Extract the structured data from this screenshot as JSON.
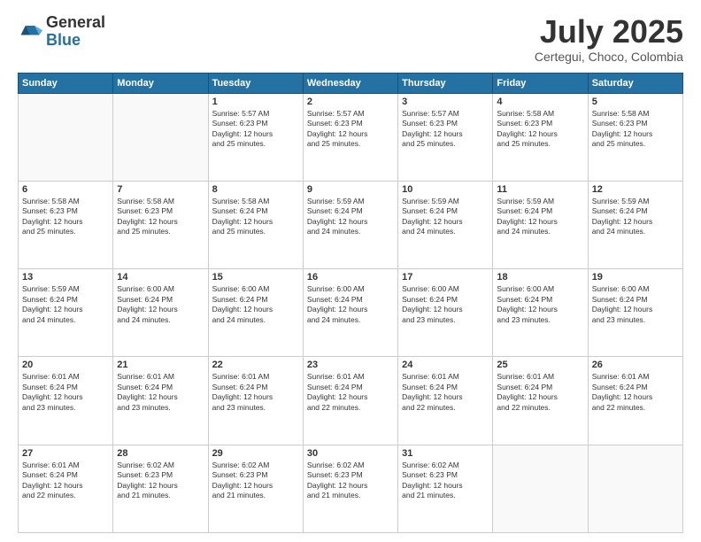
{
  "logo": {
    "general": "General",
    "blue": "Blue"
  },
  "header": {
    "month": "July 2025",
    "location": "Certegui, Choco, Colombia"
  },
  "weekdays": [
    "Sunday",
    "Monday",
    "Tuesday",
    "Wednesday",
    "Thursday",
    "Friday",
    "Saturday"
  ],
  "weeks": [
    [
      {
        "day": "",
        "info": ""
      },
      {
        "day": "",
        "info": ""
      },
      {
        "day": "1",
        "info": "Sunrise: 5:57 AM\nSunset: 6:23 PM\nDaylight: 12 hours\nand 25 minutes."
      },
      {
        "day": "2",
        "info": "Sunrise: 5:57 AM\nSunset: 6:23 PM\nDaylight: 12 hours\nand 25 minutes."
      },
      {
        "day": "3",
        "info": "Sunrise: 5:57 AM\nSunset: 6:23 PM\nDaylight: 12 hours\nand 25 minutes."
      },
      {
        "day": "4",
        "info": "Sunrise: 5:58 AM\nSunset: 6:23 PM\nDaylight: 12 hours\nand 25 minutes."
      },
      {
        "day": "5",
        "info": "Sunrise: 5:58 AM\nSunset: 6:23 PM\nDaylight: 12 hours\nand 25 minutes."
      }
    ],
    [
      {
        "day": "6",
        "info": "Sunrise: 5:58 AM\nSunset: 6:23 PM\nDaylight: 12 hours\nand 25 minutes."
      },
      {
        "day": "7",
        "info": "Sunrise: 5:58 AM\nSunset: 6:23 PM\nDaylight: 12 hours\nand 25 minutes."
      },
      {
        "day": "8",
        "info": "Sunrise: 5:58 AM\nSunset: 6:24 PM\nDaylight: 12 hours\nand 25 minutes."
      },
      {
        "day": "9",
        "info": "Sunrise: 5:59 AM\nSunset: 6:24 PM\nDaylight: 12 hours\nand 24 minutes."
      },
      {
        "day": "10",
        "info": "Sunrise: 5:59 AM\nSunset: 6:24 PM\nDaylight: 12 hours\nand 24 minutes."
      },
      {
        "day": "11",
        "info": "Sunrise: 5:59 AM\nSunset: 6:24 PM\nDaylight: 12 hours\nand 24 minutes."
      },
      {
        "day": "12",
        "info": "Sunrise: 5:59 AM\nSunset: 6:24 PM\nDaylight: 12 hours\nand 24 minutes."
      }
    ],
    [
      {
        "day": "13",
        "info": "Sunrise: 5:59 AM\nSunset: 6:24 PM\nDaylight: 12 hours\nand 24 minutes."
      },
      {
        "day": "14",
        "info": "Sunrise: 6:00 AM\nSunset: 6:24 PM\nDaylight: 12 hours\nand 24 minutes."
      },
      {
        "day": "15",
        "info": "Sunrise: 6:00 AM\nSunset: 6:24 PM\nDaylight: 12 hours\nand 24 minutes."
      },
      {
        "day": "16",
        "info": "Sunrise: 6:00 AM\nSunset: 6:24 PM\nDaylight: 12 hours\nand 24 minutes."
      },
      {
        "day": "17",
        "info": "Sunrise: 6:00 AM\nSunset: 6:24 PM\nDaylight: 12 hours\nand 23 minutes."
      },
      {
        "day": "18",
        "info": "Sunrise: 6:00 AM\nSunset: 6:24 PM\nDaylight: 12 hours\nand 23 minutes."
      },
      {
        "day": "19",
        "info": "Sunrise: 6:00 AM\nSunset: 6:24 PM\nDaylight: 12 hours\nand 23 minutes."
      }
    ],
    [
      {
        "day": "20",
        "info": "Sunrise: 6:01 AM\nSunset: 6:24 PM\nDaylight: 12 hours\nand 23 minutes."
      },
      {
        "day": "21",
        "info": "Sunrise: 6:01 AM\nSunset: 6:24 PM\nDaylight: 12 hours\nand 23 minutes."
      },
      {
        "day": "22",
        "info": "Sunrise: 6:01 AM\nSunset: 6:24 PM\nDaylight: 12 hours\nand 23 minutes."
      },
      {
        "day": "23",
        "info": "Sunrise: 6:01 AM\nSunset: 6:24 PM\nDaylight: 12 hours\nand 22 minutes."
      },
      {
        "day": "24",
        "info": "Sunrise: 6:01 AM\nSunset: 6:24 PM\nDaylight: 12 hours\nand 22 minutes."
      },
      {
        "day": "25",
        "info": "Sunrise: 6:01 AM\nSunset: 6:24 PM\nDaylight: 12 hours\nand 22 minutes."
      },
      {
        "day": "26",
        "info": "Sunrise: 6:01 AM\nSunset: 6:24 PM\nDaylight: 12 hours\nand 22 minutes."
      }
    ],
    [
      {
        "day": "27",
        "info": "Sunrise: 6:01 AM\nSunset: 6:24 PM\nDaylight: 12 hours\nand 22 minutes."
      },
      {
        "day": "28",
        "info": "Sunrise: 6:02 AM\nSunset: 6:23 PM\nDaylight: 12 hours\nand 21 minutes."
      },
      {
        "day": "29",
        "info": "Sunrise: 6:02 AM\nSunset: 6:23 PM\nDaylight: 12 hours\nand 21 minutes."
      },
      {
        "day": "30",
        "info": "Sunrise: 6:02 AM\nSunset: 6:23 PM\nDaylight: 12 hours\nand 21 minutes."
      },
      {
        "day": "31",
        "info": "Sunrise: 6:02 AM\nSunset: 6:23 PM\nDaylight: 12 hours\nand 21 minutes."
      },
      {
        "day": "",
        "info": ""
      },
      {
        "day": "",
        "info": ""
      }
    ]
  ]
}
